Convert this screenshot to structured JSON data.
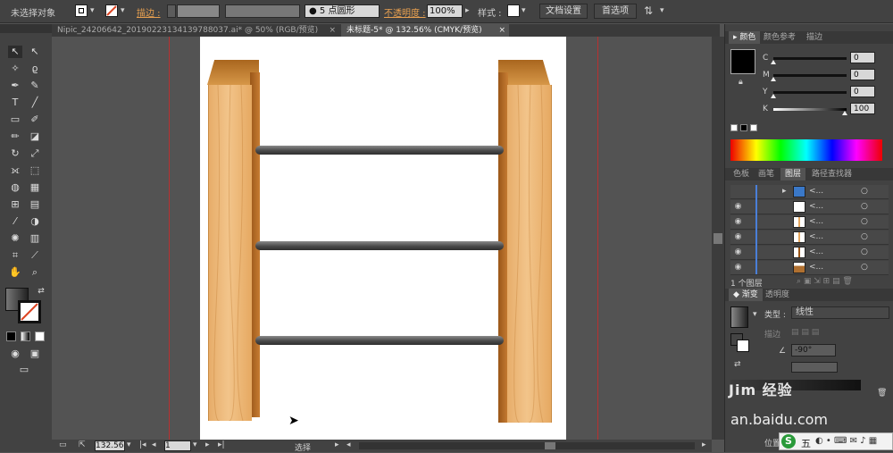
{
  "control_bar": {
    "selection_label": "未选择对象",
    "stroke_label": "描边 :",
    "brush_label": "5 点圆形",
    "opacity_label": "不透明度 :",
    "opacity_value": "100%",
    "style_label": "样式 :",
    "doc_setup": "文档设置",
    "preferences": "首选项"
  },
  "tabs": [
    {
      "label": "Nipic_24206642_20190223134139788037.ai* @ 50% (RGB/预览)",
      "close": "×"
    },
    {
      "label": "未标题-5* @ 132.56% (CMYK/预览)",
      "close": "×"
    }
  ],
  "status": {
    "zoom": "132.56",
    "page": "1",
    "tool_status": "选择"
  },
  "color_panel": {
    "tabs": [
      "颜色",
      "颜色参考",
      "描边"
    ],
    "channels": [
      {
        "name": "C",
        "value": "0",
        "level": 0
      },
      {
        "name": "M",
        "value": "0",
        "level": 0
      },
      {
        "name": "Y",
        "value": "0",
        "level": 0
      },
      {
        "name": "K",
        "value": "100",
        "level": 100
      }
    ]
  },
  "layers_panel": {
    "tabs": [
      "色板",
      "画笔",
      "图层",
      "路径查找器"
    ],
    "rows": [
      {
        "name": "<..."
      },
      {
        "name": "<..."
      },
      {
        "name": "<..."
      },
      {
        "name": "<..."
      },
      {
        "name": "<..."
      },
      {
        "name": "<..."
      }
    ],
    "footer": "1 个图层"
  },
  "gradient_panel": {
    "tabs": [
      "渐变",
      "透明度"
    ],
    "type_label": "类型 :",
    "type_value": "线性",
    "stroke_label": "描边",
    "angle_value": "-90°",
    "position_label": "位置"
  },
  "watermark": {
    "logo": "Jim 经验",
    "url": "an.baidu.com"
  },
  "tray": {
    "label": "五"
  },
  "colors": {
    "wood_light": "#f2c48a",
    "wood_mid": "#e6a962",
    "wood_dark": "#9a5618",
    "rung_dark": "#2f2f2f",
    "guide": "#b83030"
  }
}
